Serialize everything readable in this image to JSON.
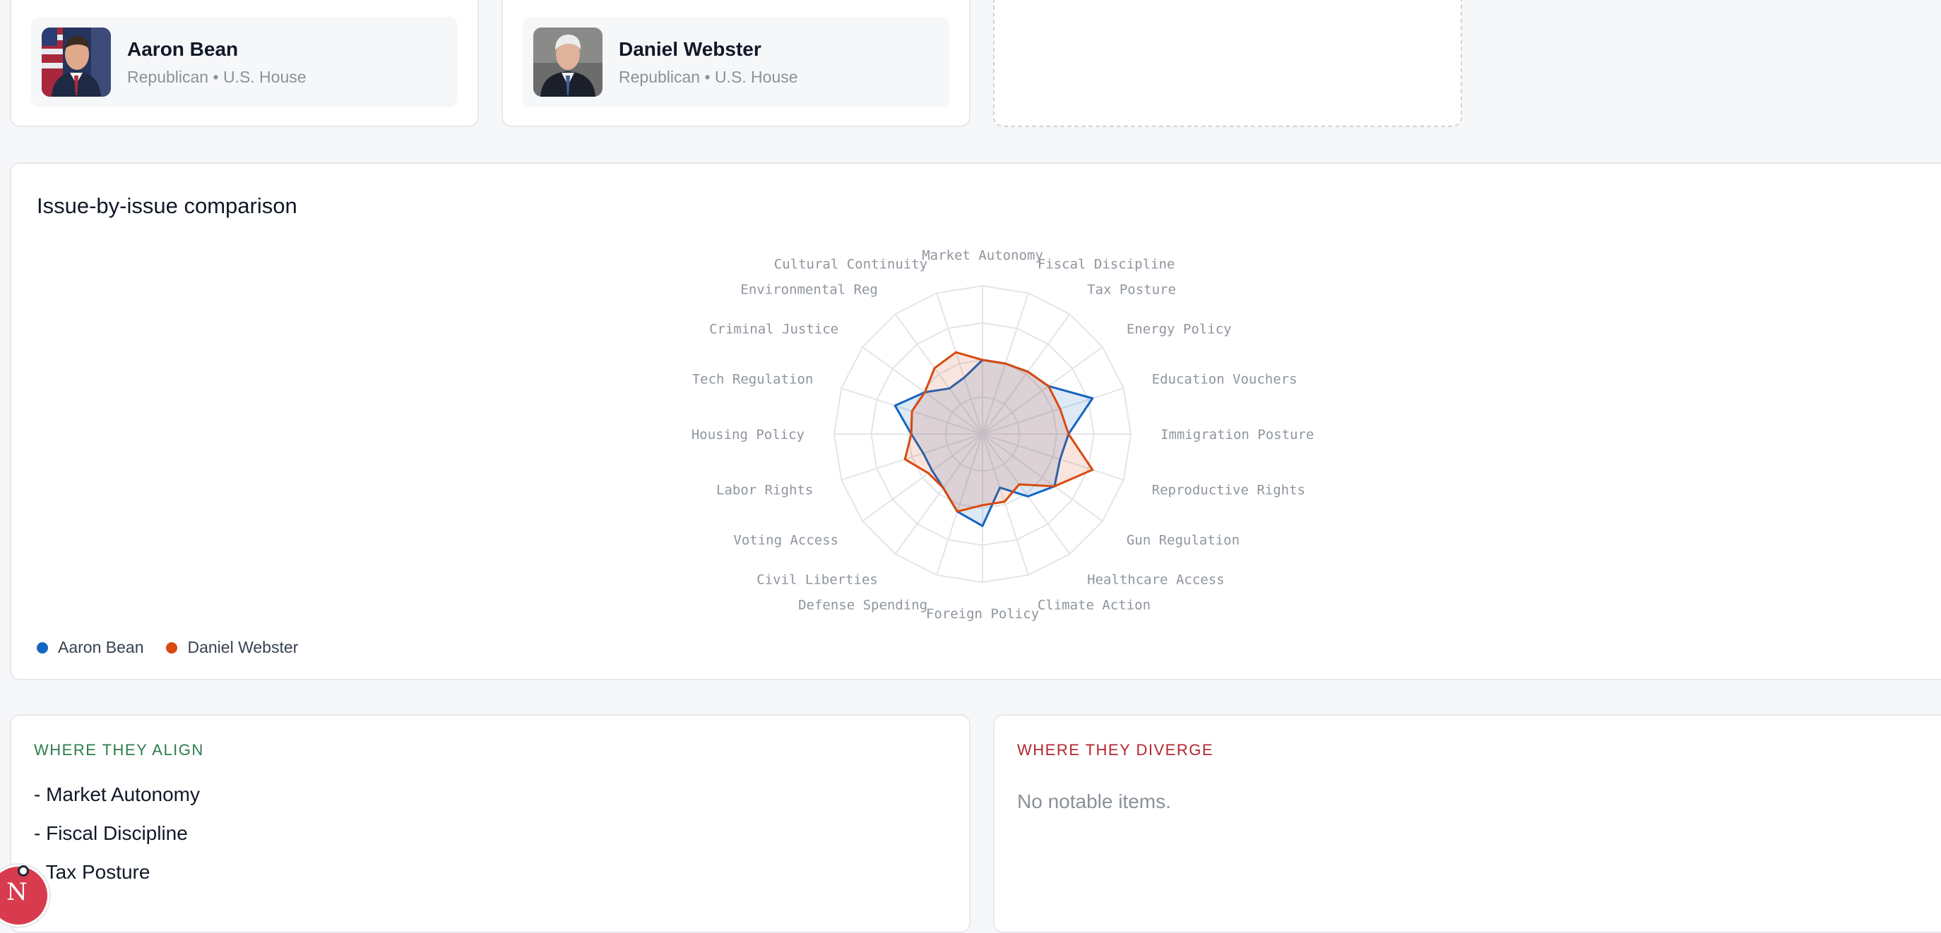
{
  "members": [
    {
      "name": "Aaron Bean",
      "party": "Republican",
      "chamber": "U.S. House",
      "avatar_icon": "portrait-photo"
    },
    {
      "name": "Daniel Webster",
      "party": "Republican",
      "chamber": "U.S. House",
      "avatar_icon": "portrait-photo"
    }
  ],
  "meta_separator": "•",
  "comparison": {
    "title": "Issue-by-issue comparison",
    "legend": [
      {
        "name": "Aaron Bean",
        "color": "#1565c0"
      },
      {
        "name": "Daniel Webster",
        "color": "#d84a10"
      }
    ]
  },
  "chart_data": {
    "type": "radar",
    "axes": [
      "Market Autonomy",
      "Fiscal Discipline",
      "Tax Posture",
      "Energy Policy",
      "Education Vouchers",
      "Immigration Posture",
      "Reproductive Rights",
      "Gun Regulation",
      "Healthcare Access",
      "Climate Action",
      "Foreign Policy",
      "Defense Spending",
      "Civil Liberties",
      "Voting Access",
      "Labor Rights",
      "Housing Policy",
      "Tech Regulation",
      "Criminal Justice",
      "Environmental Reg",
      "Cultural Continuity"
    ],
    "rings": 4,
    "series": [
      {
        "name": "Aaron Bean",
        "color": "#1565c0",
        "values": [
          0.5,
          0.5,
          0.52,
          0.55,
          0.78,
          0.58,
          0.55,
          0.6,
          0.52,
          0.38,
          0.62,
          0.55,
          0.45,
          0.42,
          0.42,
          0.48,
          0.62,
          0.48,
          0.38,
          0.4
        ]
      },
      {
        "name": "Daniel Webster",
        "color": "#d84a10",
        "values": [
          0.5,
          0.5,
          0.52,
          0.55,
          0.55,
          0.58,
          0.78,
          0.6,
          0.42,
          0.48,
          0.48,
          0.55,
          0.45,
          0.45,
          0.55,
          0.48,
          0.5,
          0.48,
          0.55,
          0.58
        ]
      }
    ]
  },
  "align": {
    "heading": "WHERE THEY ALIGN",
    "color": "#2e7d4f",
    "items": [
      "- Market Autonomy",
      "- Fiscal Discipline",
      "- Tax Posture"
    ]
  },
  "diverge": {
    "heading": "WHERE THEY DIVERGE",
    "color": "#b3262e",
    "empty_text": "No notable items."
  },
  "dev_badge": {
    "letter": "N",
    "icon": "nextjs-dev-indicator-icon"
  }
}
